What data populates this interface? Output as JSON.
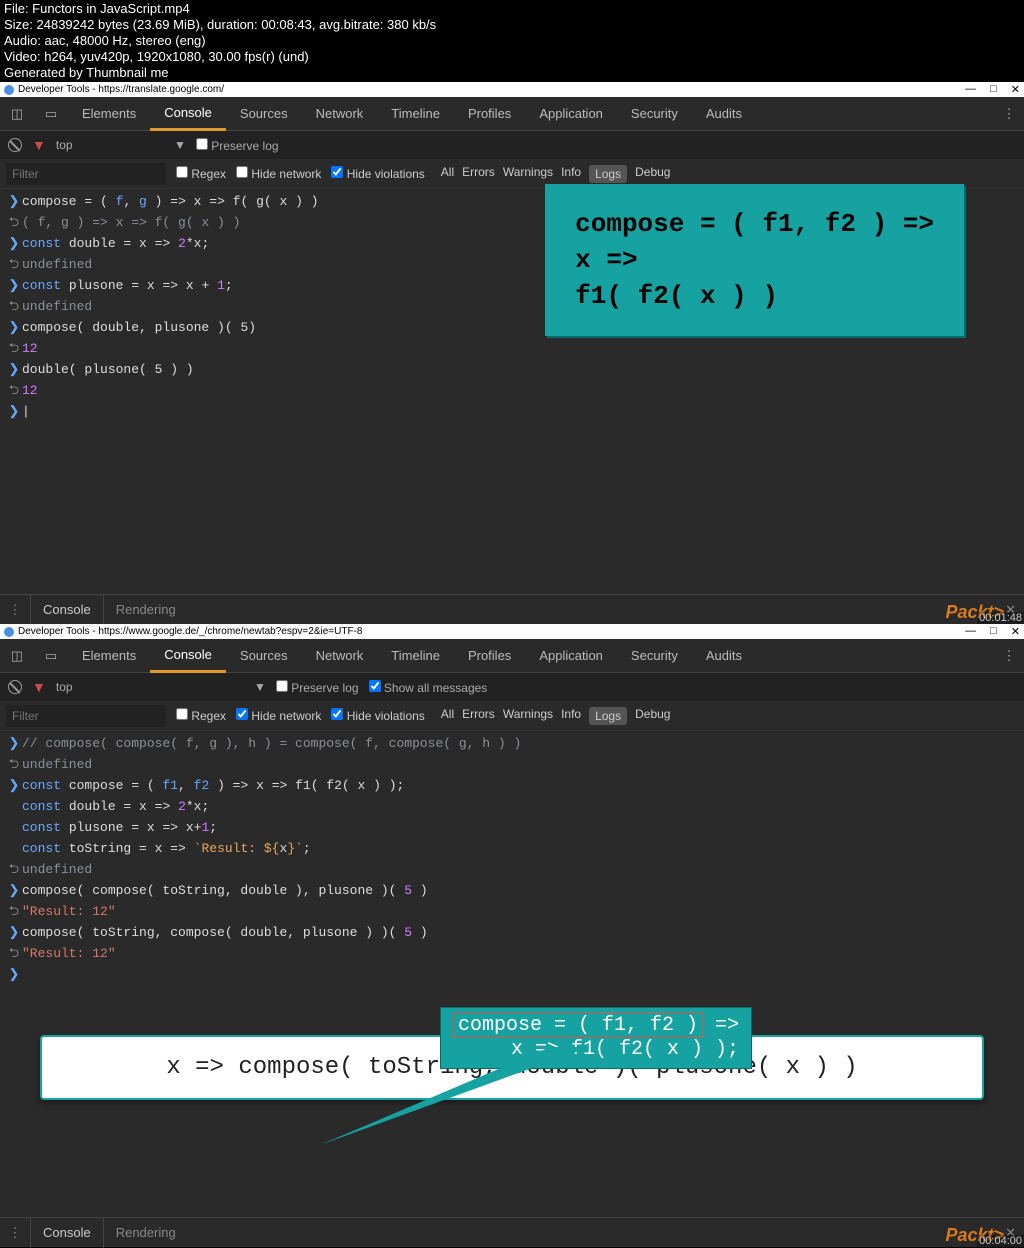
{
  "meta": {
    "file": "File: Functors in JavaScript.mp4",
    "size": "Size: 24839242 bytes (23.69 MiB), duration: 00:08:43, avg.bitrate: 380 kb/s",
    "audio": "Audio: aac, 48000 Hz, stereo (eng)",
    "video": "Video: h264, yuv420p, 1920x1080, 30.00 fps(r) (und)",
    "gen": "Generated by Thumbnail me"
  },
  "frames": [
    {
      "timestamp": "00:01:48",
      "titlebar": "Developer Tools - https://translate.google.com/",
      "tabs": [
        "Elements",
        "Console",
        "Sources",
        "Network",
        "Timeline",
        "Profiles",
        "Application",
        "Security",
        "Audits"
      ],
      "active_tab": 1,
      "filter_dd": "top",
      "preserve_log": "Preserve log",
      "show_all_messages": "",
      "filter_placeholder": "Filter",
      "regex": "Regex",
      "hide_network": "Hide network",
      "hide_violations": "Hide violations",
      "levels": [
        "All",
        "Errors",
        "Warnings",
        "Info",
        "Logs",
        "Debug"
      ],
      "active_level": 4,
      "console_lines": [
        {
          "g": ">",
          "segs": [
            [
              "compose",
              "c-white"
            ],
            [
              " = ( ",
              "c-white"
            ],
            [
              "f",
              "c-blue"
            ],
            [
              ", ",
              "c-white"
            ],
            [
              "g",
              "c-blue"
            ],
            [
              " ) => ",
              "c-white"
            ],
            [
              "x",
              "c-white"
            ],
            [
              " => f( g( ",
              "c-white"
            ],
            [
              "x",
              "c-white"
            ],
            [
              " ) )",
              "c-white"
            ]
          ]
        },
        {
          "g": "<",
          "segs": [
            [
              "( f, g ) => x => f( g( x ) )",
              "c-gray"
            ]
          ]
        },
        {
          "g": ">",
          "segs": [
            [
              "const ",
              "c-blue"
            ],
            [
              "double",
              "c-white"
            ],
            [
              " = ",
              "c-white"
            ],
            [
              "x",
              "c-white"
            ],
            [
              " => ",
              "c-white"
            ],
            [
              "2",
              "c-purple"
            ],
            [
              "*x;",
              "c-white"
            ]
          ]
        },
        {
          "g": "<",
          "segs": [
            [
              "undefined",
              "c-gray"
            ]
          ]
        },
        {
          "g": ">",
          "segs": [
            [
              "const ",
              "c-blue"
            ],
            [
              "plusone",
              "c-white"
            ],
            [
              " = ",
              "c-white"
            ],
            [
              "x",
              "c-white"
            ],
            [
              " => ",
              "c-white"
            ],
            [
              "x",
              "c-white"
            ],
            [
              " + ",
              "c-white"
            ],
            [
              "1",
              "c-purple"
            ],
            [
              ";",
              "c-white"
            ]
          ]
        },
        {
          "g": "<",
          "segs": [
            [
              "undefined",
              "c-gray"
            ]
          ]
        },
        {
          "g": ">",
          "segs": [
            [
              "compose( double, plusone )( ",
              "c-white"
            ],
            [
              "5",
              "c-white"
            ],
            [
              ")",
              "c-white"
            ]
          ]
        },
        {
          "g": "<",
          "segs": [
            [
              "12",
              "c-purple"
            ]
          ]
        },
        {
          "g": ">",
          "segs": [
            [
              "double( plusone( ",
              "c-white"
            ],
            [
              "5",
              "c-white"
            ],
            [
              " ) )",
              "c-white"
            ]
          ]
        },
        {
          "g": "<",
          "segs": [
            [
              "12",
              "c-purple"
            ]
          ]
        },
        {
          "g": ">",
          "segs": [
            [
              "|",
              "c-white"
            ]
          ]
        }
      ],
      "overlay": [
        "compose = ( f1, f2 ) =>",
        "x =>",
        "f1( f2( x ) )"
      ],
      "bottom_tabs": [
        "Console",
        "Rendering"
      ],
      "brand": "Packt>"
    },
    {
      "timestamp": "00:04:00",
      "titlebar": "Developer Tools - https://www.google.de/_/chrome/newtab?espv=2&ie=UTF-8",
      "tabs": [
        "Elements",
        "Console",
        "Sources",
        "Network",
        "Timeline",
        "Profiles",
        "Application",
        "Security",
        "Audits"
      ],
      "active_tab": 1,
      "filter_dd": "top",
      "preserve_log": "Preserve log",
      "show_all_messages": "Show all messages",
      "filter_placeholder": "Filter",
      "regex": "Regex",
      "hide_network": "Hide network",
      "hide_violations": "Hide violations",
      "levels": [
        "All",
        "Errors",
        "Warnings",
        "Info",
        "Logs",
        "Debug"
      ],
      "active_level": 4,
      "console_lines": [
        {
          "g": ">",
          "segs": [
            [
              "// compose( compose( f, g ), h ) = compose( f, compose( g, h ) )",
              "c-gray"
            ]
          ]
        },
        {
          "g": "<",
          "segs": [
            [
              "undefined",
              "c-gray"
            ]
          ]
        },
        {
          "g": ">",
          "segs": [
            [
              "const ",
              "c-blue"
            ],
            [
              "compose",
              "c-white"
            ],
            [
              " = ( ",
              "c-white"
            ],
            [
              "f1",
              "c-blue"
            ],
            [
              ", ",
              "c-white"
            ],
            [
              "f2",
              "c-blue"
            ],
            [
              " ) => ",
              "c-white"
            ],
            [
              "x",
              "c-white"
            ],
            [
              " => f1( f2( ",
              "c-white"
            ],
            [
              "x",
              "c-white"
            ],
            [
              " ) );",
              "c-white"
            ]
          ]
        },
        {
          "g": " ",
          "segs": [
            [
              "const ",
              "c-blue"
            ],
            [
              "double",
              "c-white"
            ],
            [
              " = ",
              "c-white"
            ],
            [
              "x",
              "c-white"
            ],
            [
              " => ",
              "c-white"
            ],
            [
              "2",
              "c-purple"
            ],
            [
              "*x;",
              "c-white"
            ]
          ]
        },
        {
          "g": " ",
          "segs": [
            [
              "const ",
              "c-blue"
            ],
            [
              "plusone",
              "c-white"
            ],
            [
              " = ",
              "c-white"
            ],
            [
              "x",
              "c-white"
            ],
            [
              " => ",
              "c-white"
            ],
            [
              "x",
              "c-white"
            ],
            [
              "+",
              "c-white"
            ],
            [
              "1",
              "c-purple"
            ],
            [
              ";",
              "c-white"
            ]
          ]
        },
        {
          "g": " ",
          "segs": [
            [
              "const ",
              "c-blue"
            ],
            [
              "toString",
              "c-white"
            ],
            [
              " = ",
              "c-white"
            ],
            [
              "x",
              "c-white"
            ],
            [
              " => ",
              "c-white"
            ],
            [
              "`Result: ${",
              "c-orange"
            ],
            [
              "x",
              "c-white"
            ],
            [
              "}`",
              "c-orange"
            ],
            [
              ";",
              "c-white"
            ]
          ]
        },
        {
          "g": "<",
          "segs": [
            [
              "undefined",
              "c-gray"
            ]
          ]
        },
        {
          "g": ">",
          "segs": [
            [
              "compose( compose( toString, double ), plusone )( ",
              "c-white"
            ],
            [
              "5",
              "c-purple"
            ],
            [
              " )",
              "c-white"
            ]
          ]
        },
        {
          "g": "<",
          "segs": [
            [
              "\"Result: 12\"",
              "c-str"
            ]
          ]
        },
        {
          "g": ">",
          "segs": [
            [
              "compose( toString, compose( double, plusone ) )( ",
              "c-white"
            ],
            [
              "5",
              "c-purple"
            ],
            [
              " )",
              "c-white"
            ]
          ]
        },
        {
          "g": "<",
          "segs": [
            [
              "\"Result: 12\"",
              "c-str"
            ]
          ]
        },
        {
          "g": ">",
          "segs": [
            [
              "",
              "c-white"
            ]
          ]
        }
      ],
      "callout": {
        "line1_boxed": "compose = ( f1, f2 )",
        "line1_rest": " =>",
        "line2": "x => f1( f2( x ) );"
      },
      "whitebar": "x => compose( toString, double )( plusone( x ) )",
      "bottom_tabs": [
        "Console",
        "Rendering"
      ],
      "brand": "Packt>"
    }
  ]
}
